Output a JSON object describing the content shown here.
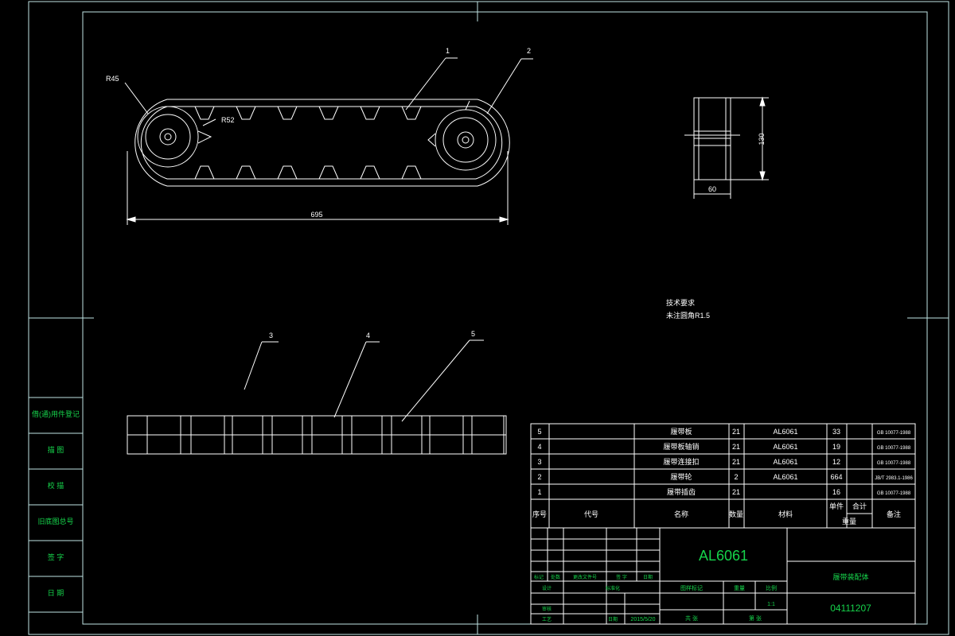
{
  "drawing": {
    "part_numbers": [
      "1",
      "2",
      "3",
      "4",
      "5"
    ],
    "dims": {
      "r45": "R45",
      "r52": "R52",
      "length": "695",
      "height": "130",
      "width": "60"
    },
    "tech": {
      "title": "技术要求",
      "line1": "未注圆角R1.5"
    }
  },
  "sidebar": {
    "rows": [
      "借(通)用件登记",
      "描 图",
      "校 描",
      "旧底图总号",
      "签 字",
      "日 期"
    ]
  },
  "bom": {
    "rows": [
      {
        "no": "5",
        "code": "",
        "name": "履带板",
        "qty": "21",
        "material": "AL6061",
        "unit": "33",
        "total": "",
        "remark": "GB 10077-1988"
      },
      {
        "no": "4",
        "code": "",
        "name": "履带板轴销",
        "qty": "21",
        "material": "AL6061",
        "unit": "19",
        "total": "",
        "remark": "GB 10077-1988"
      },
      {
        "no": "3",
        "code": "",
        "name": "履带连接扣",
        "qty": "21",
        "material": "AL6061",
        "unit": "12",
        "total": "",
        "remark": "GB 10077-1988"
      },
      {
        "no": "2",
        "code": "",
        "name": "履带轮",
        "qty": "2",
        "material": "AL6061",
        "unit": "664",
        "total": "",
        "remark": "JB/T 2983.1-1986"
      },
      {
        "no": "1",
        "code": "",
        "name": "履带插齿",
        "qty": "21",
        "material": "",
        "unit": "16",
        "total": "",
        "remark": "GB 10077-1988"
      }
    ],
    "header": {
      "no": "序号",
      "code": "代号",
      "name": "名称",
      "qty": "数量",
      "material": "材料",
      "unit": "单件",
      "total": "合计",
      "weight": "重量",
      "remark": "备注"
    }
  },
  "titleblock": {
    "material": "AL6061",
    "drawing_name": "履带装配体",
    "drawing_no": "04111207",
    "scale_label": "比例",
    "scale_value": "1:1",
    "weight_label": "重量",
    "stage_label": "图样标记",
    "sheets_label": "共 张",
    "sheet_label": "第 张",
    "labels": {
      "mark": "标记",
      "count": "处数",
      "change_doc": "更改文件号",
      "sign": "签 字",
      "date": "日期",
      "designer": "设计",
      "standard": "标准化",
      "review": "审核",
      "process": "工艺",
      "date2": "日期",
      "date_value": "2015/5/20"
    }
  },
  "colors": {
    "line": "#ffffff",
    "text": "#16d34b",
    "frame": "#bfe3e3",
    "background": "#000000"
  }
}
